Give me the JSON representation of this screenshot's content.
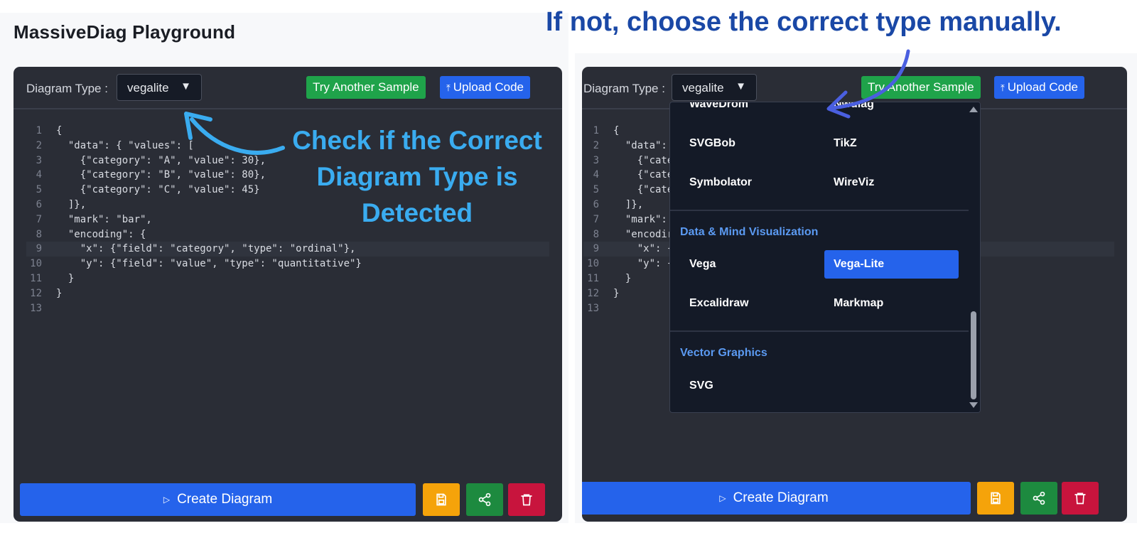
{
  "page": {
    "title": "MassiveDiag Playground"
  },
  "annotations": {
    "top_right": "If not, choose the correct type manually.",
    "left_lines": [
      "Check if the Correct",
      "Diagram Type is",
      "Detected"
    ]
  },
  "toolbar": {
    "diagram_type_label": "Diagram Type :",
    "selected_type": "vegalite",
    "try_sample_label": "Try Another Sample",
    "upload_label": "Upload Code"
  },
  "editor": {
    "lines": [
      {
        "n": "1",
        "text": "{"
      },
      {
        "n": "2",
        "text": "  \"data\": { \"values\": ["
      },
      {
        "n": "3",
        "text": "    {\"category\": \"A\", \"value\": 30},"
      },
      {
        "n": "4",
        "text": "    {\"category\": \"B\", \"value\": 80},"
      },
      {
        "n": "5",
        "text": "    {\"category\": \"C\", \"value\": 45}"
      },
      {
        "n": "6",
        "text": "  ]},"
      },
      {
        "n": "7",
        "text": "  \"mark\": \"bar\","
      },
      {
        "n": "8",
        "text": "  \"encoding\": {"
      },
      {
        "n": "9",
        "text": "    \"x\": {\"field\": \"category\", \"type\": \"ordinal\"},"
      },
      {
        "n": "10",
        "text": "    \"y\": {\"field\": \"value\", \"type\": \"quantitative\"}"
      },
      {
        "n": "11",
        "text": "  }"
      },
      {
        "n": "12",
        "text": "}"
      },
      {
        "n": "13",
        "text": ""
      }
    ],
    "right_lines": [
      {
        "n": "1",
        "text": "{"
      },
      {
        "n": "2",
        "text": "  \"data\":"
      },
      {
        "n": "3",
        "text": "    {\"cate"
      },
      {
        "n": "4",
        "text": "    {\"cate"
      },
      {
        "n": "5",
        "text": "    {\"cate"
      },
      {
        "n": "6",
        "text": "  ]},"
      },
      {
        "n": "7",
        "text": "  \"mark\":"
      },
      {
        "n": "8",
        "text": "  \"encodir"
      },
      {
        "n": "9",
        "text": "    \"x\": {"
      },
      {
        "n": "10",
        "text": "    \"y\": {"
      },
      {
        "n": "11",
        "text": "  }"
      },
      {
        "n": "12",
        "text": "}"
      },
      {
        "n": "13",
        "text": ""
      }
    ]
  },
  "footer": {
    "create_label": "Create Diagram"
  },
  "dropdown": {
    "partial_top": [
      "WaveDrom",
      "Nwdiag"
    ],
    "row1": [
      "SVGBob",
      "TikZ"
    ],
    "row2": [
      "Symbolator",
      "WireViz"
    ],
    "group1": "Data & Mind Visualization",
    "row3": [
      "Vega",
      "Vega-Lite"
    ],
    "row4": [
      "Excalidraw",
      "Markmap"
    ],
    "group2": "Vector Graphics",
    "row5": [
      "SVG"
    ]
  },
  "colors": {
    "panel_bg": "#2a2d36",
    "primary": "#2563eb",
    "success": "#1fa34a",
    "warning": "#f5a30a",
    "share": "#1d8a3f",
    "danger": "#c8143d",
    "annot_blue_dark": "#1a48a6",
    "annot_blue_light": "#3aacf0"
  }
}
